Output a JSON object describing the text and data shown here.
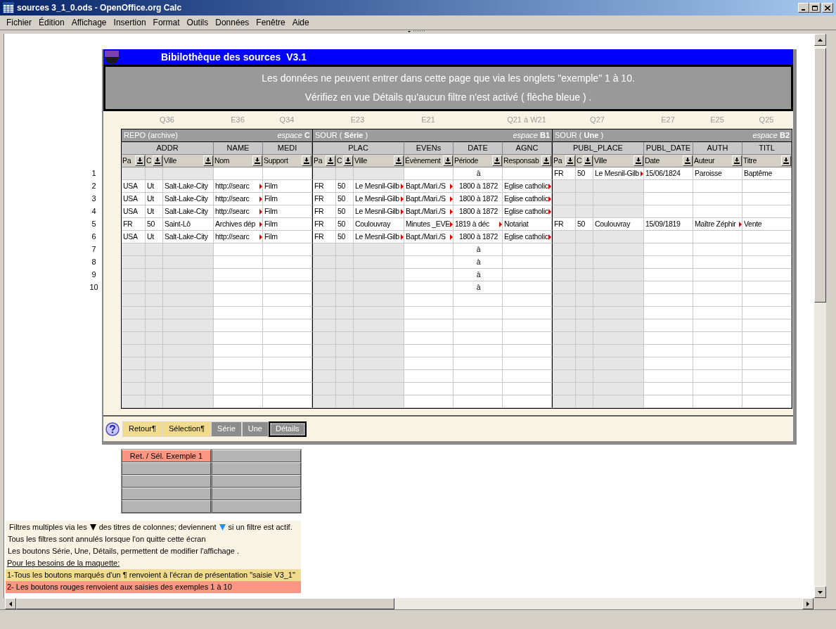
{
  "window": {
    "title": "sources 3_1_0.ods - OpenOffice.org Calc"
  },
  "menu": [
    "Fichier",
    "Édition",
    "Affichage",
    "Insertion",
    "Format",
    "Outils",
    "Données",
    "Fenêtre",
    "Aide"
  ],
  "panel": {
    "title": "Bibilothèque des sources  V3.1",
    "message": [
      "Les données ne peuvent entrer dans cette page que via les onglets \"exemple\" 1 à 10.",
      "Vérifiez en vue Détails qu'aucun filtre n'est activé ( flèche bleue ) ."
    ],
    "groups": [
      {
        "title": "REPO (archive)",
        "space": "*espace* **C**",
        "columns": [
          {
            "kind": "place",
            "label": "ADDR",
            "ref": "Q36",
            "subs": [
              "Pa",
              "C",
              "Ville"
            ]
          },
          {
            "kind": "field",
            "label": "NAME",
            "ref": "E36",
            "subs": [
              "Nom"
            ]
          },
          {
            "kind": "field",
            "label": "MEDI",
            "ref": "Q34",
            "subs": [
              "Support"
            ]
          }
        ]
      },
      {
        "title": "SOUR ( **Série** )",
        "space": "*espace* **B1**",
        "columns": [
          {
            "kind": "place",
            "label": "PLAC",
            "ref": "E23",
            "subs": [
              "Pa",
              "C",
              "Ville"
            ]
          },
          {
            "kind": "field",
            "label": "EVENs",
            "ref": "E21",
            "subs": [
              "Évènement"
            ]
          },
          {
            "kind": "field",
            "label": "DATE",
            "subs": [
              "Période"
            ]
          },
          {
            "kind": "field",
            "label": "AGNC",
            "ref": "Q21 à W21",
            "subs": [
              "Responsab"
            ]
          }
        ]
      },
      {
        "title": "SOUR ( **Une** )",
        "space": "*espace* **B2**",
        "columns": [
          {
            "kind": "place",
            "label": "PUBL_PLACE",
            "ref": "Q27",
            "subs": [
              "Pa",
              "C",
              "Ville"
            ]
          },
          {
            "kind": "field",
            "label": "PUBL_DATE",
            "ref": "E27",
            "subs": [
              "Date"
            ]
          },
          {
            "kind": "field",
            "label": "AUTH",
            "ref": "E25",
            "subs": [
              "Auteur"
            ]
          },
          {
            "kind": "field",
            "label": "TITL",
            "ref": "Q25",
            "subs": [
              "Titre"
            ]
          }
        ]
      }
    ],
    "rows": [
      {
        "number": "1",
        "cells": [
          null,
          null,
          null,
          null,
          null,
          null,
          null,
          null,
          null,
          {
            "text": "à",
            "clipped": false
          },
          null,
          {
            "text": "FR",
            "clipped": false
          },
          {
            "text": "50",
            "clipped": false
          },
          {
            "text": "Le Mesnil-Gilb",
            "clipped": true
          },
          {
            "text": "15/06/1824",
            "clipped": false
          },
          {
            "text": "Paroisse",
            "clipped": false
          },
          {
            "text": "Baptême",
            "clipped": false
          }
        ]
      },
      {
        "number": "2",
        "cells": [
          {
            "text": "USA",
            "clipped": false
          },
          {
            "text": "Ut",
            "clipped": false
          },
          {
            "text": "Salt-Lake-City",
            "clipped": false
          },
          {
            "text": "http://searc",
            "clipped": true
          },
          {
            "text": "Film",
            "clipped": false
          },
          {
            "text": "FR",
            "clipped": false
          },
          {
            "text": "50",
            "clipped": false
          },
          {
            "text": "Le Mesnil-Gilb",
            "clipped": true
          },
          {
            "text": "Bapt./Mari./S",
            "clipped": true
          },
          {
            "text": "1800 à 1872",
            "clipped": false
          },
          {
            "text": "Eglise catholic",
            "clipped": true
          },
          null,
          null,
          null,
          null,
          null,
          null
        ]
      },
      {
        "number": "3",
        "cells": [
          {
            "text": "USA",
            "clipped": false
          },
          {
            "text": "Ut",
            "clipped": false
          },
          {
            "text": "Salt-Lake-City",
            "clipped": false
          },
          {
            "text": "http://searc",
            "clipped": true
          },
          {
            "text": "Film",
            "clipped": false
          },
          {
            "text": "FR",
            "clipped": false
          },
          {
            "text": "50",
            "clipped": false
          },
          {
            "text": "Le Mesnil-Gilb",
            "clipped": true
          },
          {
            "text": "Bapt./Mari./S",
            "clipped": true
          },
          {
            "text": "1800 à 1872",
            "clipped": false
          },
          {
            "text": "Eglise catholic",
            "clipped": true
          },
          null,
          null,
          null,
          null,
          null,
          null
        ]
      },
      {
        "number": "4",
        "cells": [
          {
            "text": "USA",
            "clipped": false
          },
          {
            "text": "Ut",
            "clipped": false
          },
          {
            "text": "Salt-Lake-City",
            "clipped": false
          },
          {
            "text": "http://searc",
            "clipped": true
          },
          {
            "text": "Film",
            "clipped": false
          },
          {
            "text": "FR",
            "clipped": false
          },
          {
            "text": "50",
            "clipped": false
          },
          {
            "text": "Le Mesnil-Gilb",
            "clipped": true
          },
          {
            "text": "Bapt./Mari./S",
            "clipped": true
          },
          {
            "text": "1800 à 1872",
            "clipped": false
          },
          {
            "text": "Eglise catholic",
            "clipped": true
          },
          null,
          null,
          null,
          null,
          null,
          null
        ]
      },
      {
        "number": "5",
        "cells": [
          {
            "text": "FR",
            "clipped": false
          },
          {
            "text": "50",
            "clipped": false
          },
          {
            "text": "Saint-Lô",
            "clipped": false
          },
          {
            "text": "Archives dép",
            "clipped": true
          },
          {
            "text": "Film",
            "clipped": false
          },
          {
            "text": "FR",
            "clipped": false
          },
          {
            "text": "50",
            "clipped": false
          },
          {
            "text": "Coulouvray",
            "clipped": false
          },
          {
            "text": "Minutes _EVE",
            "clipped": true
          },
          {
            "text": "1819 à déc",
            "clipped": true
          },
          {
            "text": "Notariat",
            "clipped": false
          },
          {
            "text": "FR",
            "clipped": false
          },
          {
            "text": "50",
            "clipped": false
          },
          {
            "text": "Coulouvray",
            "clipped": false
          },
          {
            "text": "15/09/1819",
            "clipped": false
          },
          {
            "text": "Maître Zéphir",
            "clipped": true
          },
          {
            "text": "Vente",
            "clipped": false
          }
        ]
      },
      {
        "number": "6",
        "cells": [
          {
            "text": "USA",
            "clipped": false
          },
          {
            "text": "Ut",
            "clipped": false
          },
          {
            "text": "Salt-Lake-City",
            "clipped": false
          },
          {
            "text": "http://searc",
            "clipped": true
          },
          {
            "text": "Film",
            "clipped": false
          },
          {
            "text": "FR",
            "clipped": false
          },
          {
            "text": "50",
            "clipped": false
          },
          {
            "text": "Le Mesnil-Gilb",
            "clipped": true
          },
          {
            "text": "Bapt./Mari./S",
            "clipped": true
          },
          {
            "text": "1800 à 1872",
            "clipped": false
          },
          {
            "text": "Eglise catholic",
            "clipped": true
          },
          null,
          null,
          null,
          null,
          null,
          null
        ]
      },
      {
        "number": "7",
        "cells": [
          null,
          null,
          null,
          null,
          null,
          null,
          null,
          null,
          null,
          {
            "text": "à",
            "clipped": false
          },
          null,
          null,
          null,
          null,
          null,
          null,
          null
        ]
      },
      {
        "number": "8",
        "cells": [
          null,
          null,
          null,
          null,
          null,
          null,
          null,
          null,
          null,
          {
            "text": "à",
            "clipped": false
          },
          null,
          null,
          null,
          null,
          null,
          null,
          null
        ]
      },
      {
        "number": "9",
        "cells": [
          null,
          null,
          null,
          null,
          null,
          null,
          null,
          null,
          null,
          {
            "text": "à",
            "clipped": false
          },
          null,
          null,
          null,
          null,
          null,
          null,
          null
        ]
      },
      {
        "number": "10",
        "cells": [
          null,
          null,
          null,
          null,
          null,
          null,
          null,
          null,
          null,
          {
            "text": "à",
            "clipped": false
          },
          null,
          null,
          null,
          null,
          null,
          null,
          null
        ]
      }
    ],
    "buttons": [
      {
        "label": "Retour¶",
        "color": "#f0dc8c",
        "selected": false
      },
      {
        "label": "Sélection¶",
        "color": "#f0dc8c",
        "selected": false
      },
      {
        "label": "Série",
        "color": "#8c8c8c",
        "selected": false
      },
      {
        "label": "Une",
        "color": "#8c8c8c",
        "selected": false
      },
      {
        "label": "Détails",
        "color": "#8c8c8c",
        "selected": true
      }
    ]
  },
  "examples": [
    {
      "label": "Ret. / Sél. Exemple 1",
      "color": "#fa9682"
    },
    {
      "color": "#b4b4b4"
    },
    {
      "color": "#b4b4b4"
    },
    {
      "color": "#b4b4b4"
    },
    {
      "color": "#b4b4b4"
    },
    {
      "color": "#b4b4b4"
    },
    {
      "color": "#b4b4b4"
    },
    {
      "color": "#b4b4b4"
    },
    {
      "color": "#b4b4b4"
    },
    {
      "color": "#b4b4b4"
    }
  ],
  "notes": [
    {
      "kind": "legend",
      "parts": [
        {
          "kind": "text",
          "text": "Filtres multiples via les"
        },
        {
          "kind": "icon",
          "color": "#000000"
        },
        {
          "kind": "text",
          "text": "des titres de colonnes; deviennent"
        },
        {
          "kind": "icon",
          "color": "#1e90ff"
        },
        {
          "kind": "text",
          "text": "si un filtre est actif."
        }
      ]
    },
    {
      "kind": "text",
      "text": "Tous les filtres sont annulés lorsque l'on quitte cette écran"
    },
    {
      "kind": "text",
      "text": "Les boutons Série, Une, Détails, permettent de modifier l'affichage ."
    },
    {
      "kind": "heading",
      "text": "Pour les besoins de la maquette:"
    },
    {
      "kind": "highlight",
      "color": "#f0dc8c",
      "text": "1-Tous les boutons marqués d'un ¶ renvoient à l'écran de présentation \"saisie V3_1\""
    },
    {
      "kind": "highlight",
      "color": "#fa9682",
      "text": "2- Les boutons rouges renvoient aux saisies des exemples 1 à 10"
    }
  ]
}
